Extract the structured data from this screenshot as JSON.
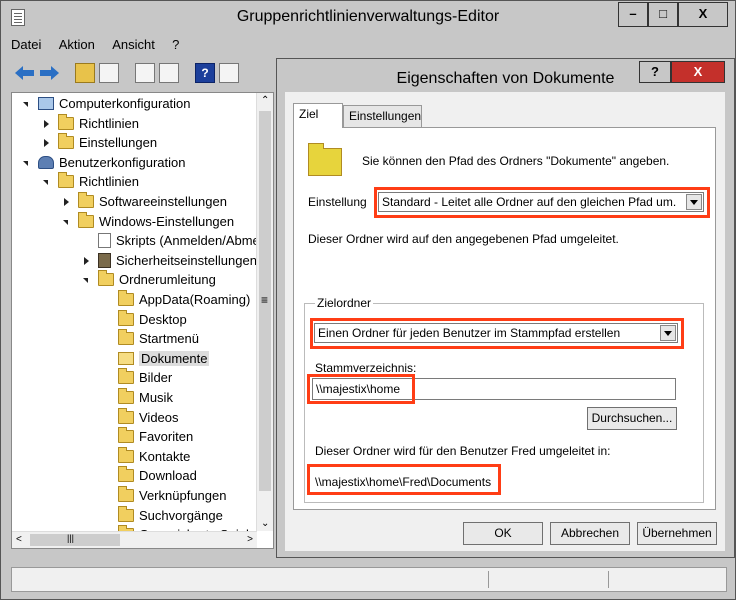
{
  "window": {
    "title": "Gruppenrichtlinienverwaltungs-Editor",
    "controls": [
      "–",
      "□",
      "X"
    ]
  },
  "menu": [
    "Datei",
    "Aktion",
    "Ansicht",
    "?"
  ],
  "toolbar": {
    "help_glyph": "?"
  },
  "tree": {
    "items": [
      {
        "label": "Computerkonfiguration",
        "icon": "computer-icon",
        "expander": "open"
      },
      {
        "label": "Richtlinien",
        "icon": "folder-icon",
        "expander": "closed"
      },
      {
        "label": "Einstellungen",
        "icon": "folder-icon",
        "expander": "closed"
      },
      {
        "label": "Benutzerkonfiguration",
        "icon": "users-icon",
        "expander": "open"
      },
      {
        "label": "Richtlinien",
        "icon": "folder-icon",
        "expander": "open"
      },
      {
        "label": "Softwareeinstellungen",
        "icon": "folder-icon",
        "expander": "closed"
      },
      {
        "label": "Windows-Einstellungen",
        "icon": "folder-icon",
        "expander": "open"
      },
      {
        "label": "Skripts (Anmelden/Abmelden)",
        "icon": "script-icon",
        "expander": "none"
      },
      {
        "label": "Sicherheitseinstellungen",
        "icon": "security-icon",
        "expander": "closed"
      },
      {
        "label": "Ordnerumleitung",
        "icon": "folder-icon",
        "expander": "open"
      },
      {
        "label": "AppData(Roaming)",
        "icon": "folder-icon",
        "expander": "none"
      },
      {
        "label": "Desktop",
        "icon": "folder-icon",
        "expander": "none"
      },
      {
        "label": "Startmenü",
        "icon": "folder-icon",
        "expander": "none"
      },
      {
        "label": "Dokumente",
        "icon": "open-folder-icon",
        "expander": "none",
        "selected": true
      },
      {
        "label": "Bilder",
        "icon": "folder-icon",
        "expander": "none"
      },
      {
        "label": "Musik",
        "icon": "folder-icon",
        "expander": "none"
      },
      {
        "label": "Videos",
        "icon": "folder-icon",
        "expander": "none"
      },
      {
        "label": "Favoriten",
        "icon": "folder-icon",
        "expander": "none"
      },
      {
        "label": "Kontakte",
        "icon": "folder-icon",
        "expander": "none"
      },
      {
        "label": "Download",
        "icon": "folder-icon",
        "expander": "none"
      },
      {
        "label": "Verknüpfungen",
        "icon": "folder-icon",
        "expander": "none"
      },
      {
        "label": "Suchvorgänge",
        "icon": "folder-icon",
        "expander": "none"
      },
      {
        "label": "Gespeicherte Spiele",
        "icon": "folder-icon",
        "expander": "none"
      }
    ]
  },
  "dialog": {
    "title": "Eigenschaften von Dokumente",
    "help_label": "?",
    "close_label": "X",
    "tabs": [
      {
        "label": "Ziel",
        "active": true
      },
      {
        "label": "Einstellungen",
        "active": false
      }
    ],
    "intro_text": "Sie können den Pfad des Ordners \"Dokumente\" angeben.",
    "setting_label": "Einstellung",
    "setting_value": "Standard - Leitet alle Ordner auf den gleichen Pfad um.",
    "setting_info": "Dieser Ordner wird auf den angegebenen Pfad umgeleitet.",
    "target_group_label": "Zielordner",
    "target_value": "Einen Ordner für jeden Benutzer im Stammpfad erstellen",
    "root_label": "Stammverzeichnis:",
    "root_value": "\\\\majestix\\home",
    "browse_label": "Durchsuchen...",
    "user_info": "Dieser Ordner wird für den Benutzer Fred umgeleitet in:",
    "user_path": "\\\\majestix\\home\\Fred\\Documents",
    "ok_label": "OK",
    "cancel_label": "Abbrechen",
    "apply_label": "Übernehmen",
    "highlight_color": "#ff3d15"
  }
}
